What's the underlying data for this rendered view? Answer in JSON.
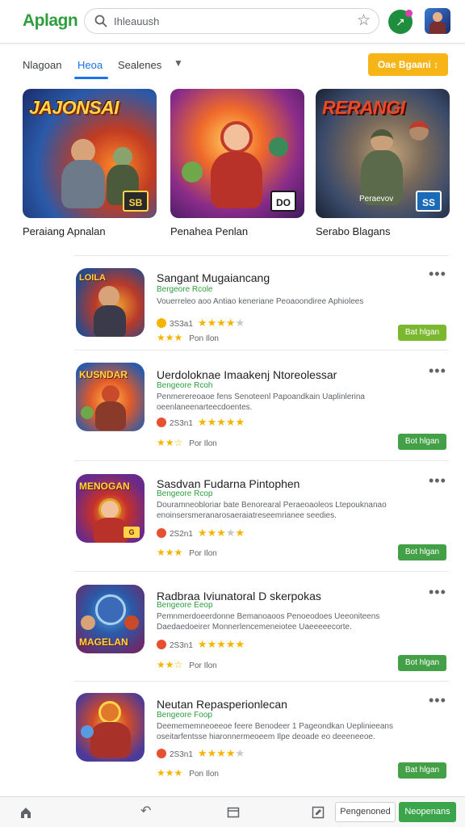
{
  "header": {
    "logo": "Aplagn",
    "search_text": "Ihleauush",
    "search_icon": "search-icon",
    "bookmark_icon": "star-outline-icon",
    "notify_avatar_symbol": "↗"
  },
  "tabs": [
    {
      "label": "Nlagoan"
    },
    {
      "label": "Heoa"
    },
    {
      "label": "Sealenes"
    }
  ],
  "cta_label": "Oae Bgaani ↕",
  "featured": [
    {
      "art_title": "JAJONSAI",
      "badge": "SB",
      "label": "Peraiang Apnalan"
    },
    {
      "art_title": "",
      "badge": "DO",
      "label": "Penahea Penlan"
    },
    {
      "art_title": "RERANGI",
      "badge": "SS",
      "tag": "Peraevov",
      "label": "Serabo Blagans"
    }
  ],
  "apps": [
    {
      "icon_title": "LOILA",
      "title": "Sangant Mugaiancang",
      "subtitle": "Bergeore Rcole",
      "description": "Vouerreleo aoo Antiao keneriane Peoaoondiree Aphiolees",
      "rating_badge_color": "#f5b400",
      "rating_num": "3S3a1",
      "rating_stars": 3.5,
      "small_stars": 3,
      "small_text": "Pon Ilon",
      "button_label": "Bat hlgan",
      "button_style": "lime"
    },
    {
      "icon_title": "KUSNDAR",
      "title": "Uerdoloknae Imaakenj Ntoreolessar",
      "subtitle": "Bengeore Rcoh",
      "description": "Penmerereoaoe fens Senoteenl Papoandkain Uaplinlerina oeenlaneenarteecdoentes.",
      "rating_badge_color": "#e8512f",
      "rating_num": "2S3n1",
      "rating_stars": 5,
      "small_stars": 2.5,
      "small_text": "Por Ilon",
      "button_label": "Bot hlgan",
      "button_style": "green"
    },
    {
      "icon_title": "MENOGAN",
      "title": "Sasdvan Fudarna Pintophen",
      "subtitle": "Bengeore Rcop",
      "description": "Douramneobloriar bate Benorearal Peraeoaoleos Ltepouknanao enoinsersmeranarosaeraiatreseemrianee seedies.",
      "rating_badge_color": "#e8512f",
      "rating_num": "2S2n1",
      "rating_stars": 3.5,
      "small_stars": 3,
      "small_text": "Por Ilon",
      "button_label": "Bot hlgan",
      "button_style": "green"
    },
    {
      "icon_title": "MAGELAN",
      "title": "Radbraa Iviunatoral D skerpokas",
      "subtitle": "Bengeore Eeop",
      "description": "Pemnmerdoeerdonne Bemanoaoos Penoeodoes Ueeoniteens Daedaedoeirer Monnerlencemeneiotee Uaeeeeecorte.",
      "rating_badge_color": "#e8512f",
      "rating_num": "2S3n1",
      "rating_stars": 5,
      "small_stars": 2.5,
      "small_text": "Por Ilon",
      "button_label": "Bot hlgan",
      "button_style": "green"
    },
    {
      "icon_title": "",
      "title": "Neutan Repasperionlecan",
      "subtitle": "Bengeore Foop",
      "description": "Deemememneoeeoe feere Benodeer 1 Pageondkan Ueplinieeans oseitarfentsse hiaronnermeoeem Ilpe deoade eo deeeneeoe.",
      "rating_badge_color": "#e8512f",
      "rating_num": "2S3n1",
      "rating_stars": 3.5,
      "small_stars": 3,
      "small_text": "Pon Ilon",
      "button_label": "Bat hlgan",
      "button_style": "green"
    }
  ],
  "bottom_bar": {
    "outline_button": "Pengenoned",
    "fill_button": "Neopenans"
  },
  "colors": {
    "brand_green": "#2e9e3e",
    "accent_blue": "#1a73e8",
    "cta_yellow": "#f7b417",
    "button_green": "#43a047"
  }
}
